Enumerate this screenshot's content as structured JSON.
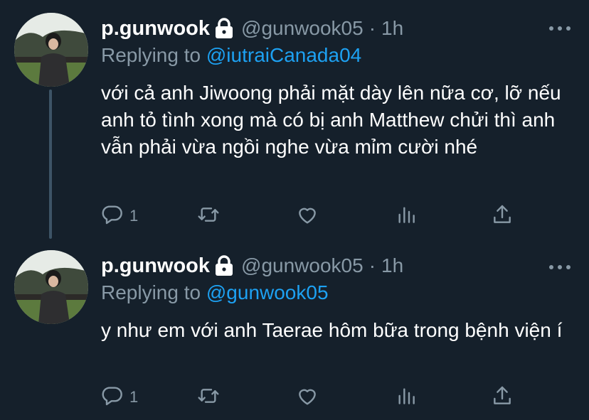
{
  "tweets": [
    {
      "display_name": "p.gunwook",
      "handle": "@gunwook05",
      "separator": "·",
      "time": "1h",
      "replying_prefix": "Replying to",
      "replying_to": "@iutraiCanada04",
      "text": "với cả anh Jiwoong phải mặt dày lên nữa cơ, lỡ nếu anh tỏ tình xong mà có bị anh Matthew chửi thì anh vẫn phải vừa ngồi nghe vừa mỉm cười nhé",
      "reply_count": "1"
    },
    {
      "display_name": "p.gunwook",
      "handle": "@gunwook05",
      "separator": "·",
      "time": "1h",
      "replying_prefix": "Replying to",
      "replying_to": "@gunwook05",
      "text": "y như em với anh Taerae hôm bữa trong bệnh viện í",
      "reply_count": "1"
    }
  ],
  "colors": {
    "background": "#15202b",
    "secondary_text": "#8899a6",
    "accent": "#1da1f2",
    "thread_line": "#3d5466"
  },
  "icons": [
    "lock-icon",
    "more-icon",
    "reply-icon",
    "retweet-icon",
    "like-icon",
    "stats-icon",
    "share-icon"
  ]
}
